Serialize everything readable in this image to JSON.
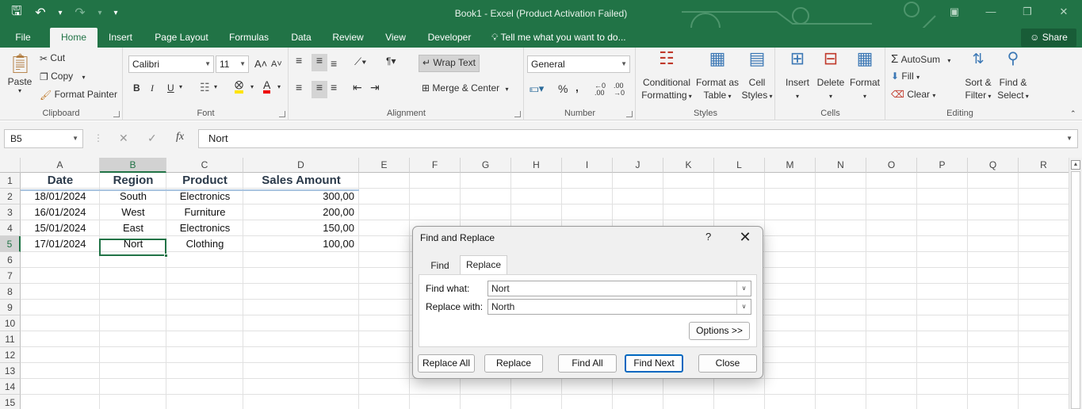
{
  "window": {
    "title": "Book1  -  Excel (Product Activation Failed)",
    "qat": {
      "save_icon": "save-icon",
      "undo_icon": "undo-icon",
      "redo_icon": "redo-icon"
    }
  },
  "tabs": [
    {
      "label": "File",
      "active": false
    },
    {
      "label": "Home",
      "active": true
    },
    {
      "label": "Insert",
      "active": false
    },
    {
      "label": "Page Layout",
      "active": false
    },
    {
      "label": "Formulas",
      "active": false
    },
    {
      "label": "Data",
      "active": false
    },
    {
      "label": "Review",
      "active": false
    },
    {
      "label": "View",
      "active": false
    },
    {
      "label": "Developer",
      "active": false
    }
  ],
  "tellme": "Tell me what you want to do...",
  "share": "Share",
  "ribbon": {
    "clipboard": {
      "label": "Clipboard",
      "paste": "Paste",
      "cut": "Cut",
      "copy": "Copy",
      "format_painter": "Format Painter"
    },
    "font": {
      "label": "Font",
      "name": "Calibri",
      "size": "11"
    },
    "alignment": {
      "label": "Alignment",
      "wrap_text": "Wrap Text",
      "merge_center": "Merge & Center"
    },
    "number": {
      "label": "Number",
      "format": "General"
    },
    "styles": {
      "label": "Styles",
      "conditional_1": "Conditional",
      "conditional_2": "Formatting",
      "format_table_1": "Format as",
      "format_table_2": "Table",
      "cell_styles_1": "Cell",
      "cell_styles_2": "Styles"
    },
    "cells": {
      "label": "Cells",
      "insert": "Insert",
      "delete": "Delete",
      "format": "Format"
    },
    "editing": {
      "label": "Editing",
      "autosum": "AutoSum",
      "fill": "Fill",
      "clear": "Clear",
      "sort_1": "Sort &",
      "sort_2": "Filter",
      "find_1": "Find &",
      "find_2": "Select"
    }
  },
  "formula_bar": {
    "name_box": "B5",
    "fx": "fx",
    "content": "Nort"
  },
  "columns": [
    "A",
    "B",
    "C",
    "D",
    "E",
    "F",
    "G",
    "H",
    "I",
    "J",
    "K",
    "L",
    "M",
    "N",
    "O",
    "P",
    "Q",
    "R"
  ],
  "rows": [
    "1",
    "2",
    "3",
    "4",
    "5",
    "6",
    "7",
    "8",
    "9",
    "10",
    "11",
    "12",
    "13",
    "14",
    "15"
  ],
  "sheet": {
    "headers": [
      "Date",
      "Region",
      "Product",
      "Sales Amount"
    ],
    "data": [
      [
        "18/01/2024",
        "South",
        "Electronics",
        "300,00"
      ],
      [
        "16/01/2024",
        "West",
        "Furniture",
        "200,00"
      ],
      [
        "15/01/2024",
        "East",
        "Electronics",
        "150,00"
      ],
      [
        "17/01/2024",
        "Nort",
        "Clothing",
        "100,00"
      ]
    ]
  },
  "dialog": {
    "title": "Find and Replace",
    "help": "?",
    "tabs": {
      "find": "Find",
      "replace": "Replace"
    },
    "find_what_label": "Find what:",
    "find_what_value": "Nort",
    "replace_with_label": "Replace with:",
    "replace_with_value": "North",
    "options": "Options >>",
    "buttons": {
      "replace_all": "Replace All",
      "replace": "Replace",
      "find_all": "Find All",
      "find_next": "Find Next",
      "close": "Close"
    }
  },
  "colors": {
    "accent": "#217346",
    "dialog_default": "#0067c0"
  }
}
